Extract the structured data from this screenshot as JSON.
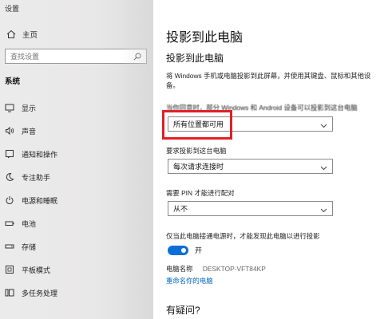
{
  "window": {
    "title": "设置"
  },
  "sidebar": {
    "home_label": "主页",
    "search_placeholder": "查找设置",
    "section_label": "系统",
    "items": [
      {
        "label": "显示",
        "icon": "monitor-icon"
      },
      {
        "label": "声音",
        "icon": "speaker-icon"
      },
      {
        "label": "通知和操作",
        "icon": "notification-icon"
      },
      {
        "label": "专注助手",
        "icon": "moon-icon"
      },
      {
        "label": "电源和睡眠",
        "icon": "power-icon"
      },
      {
        "label": "电池",
        "icon": "battery-icon"
      },
      {
        "label": "存储",
        "icon": "storage-icon"
      },
      {
        "label": "平板模式",
        "icon": "tablet-icon"
      },
      {
        "label": "多任务处理",
        "icon": "multitask-icon"
      }
    ]
  },
  "main": {
    "page_title": "投影到此电脑",
    "sub_title": "投影到此电脑",
    "description": "将 Windows 手机或电脑投影到此屏幕，并使用其键盘、鼠标和其他设备。",
    "availability_label": "当你同意时，部分 Windows 和 Android 设备可以投影到这台电脑",
    "availability_value": "所有位置都可用",
    "ask_label": "要求投影到这台电脑",
    "ask_value": "每次请求连接时",
    "pin_label": "需要 PIN 才能进行配对",
    "pin_value": "从不",
    "power_label": "仅当此电脑接通电源时，才能发现此电脑以进行投影",
    "toggle_value": "开",
    "pc_name_label": "电脑名称",
    "pc_name_value": "DESKTOP-VFT84KP",
    "rename_link": "重命名你的电脑",
    "questions_heading": "有疑问?"
  },
  "colors": {
    "accent": "#0a6fd6",
    "highlight_box": "#e21f26",
    "link": "#0067c0"
  }
}
